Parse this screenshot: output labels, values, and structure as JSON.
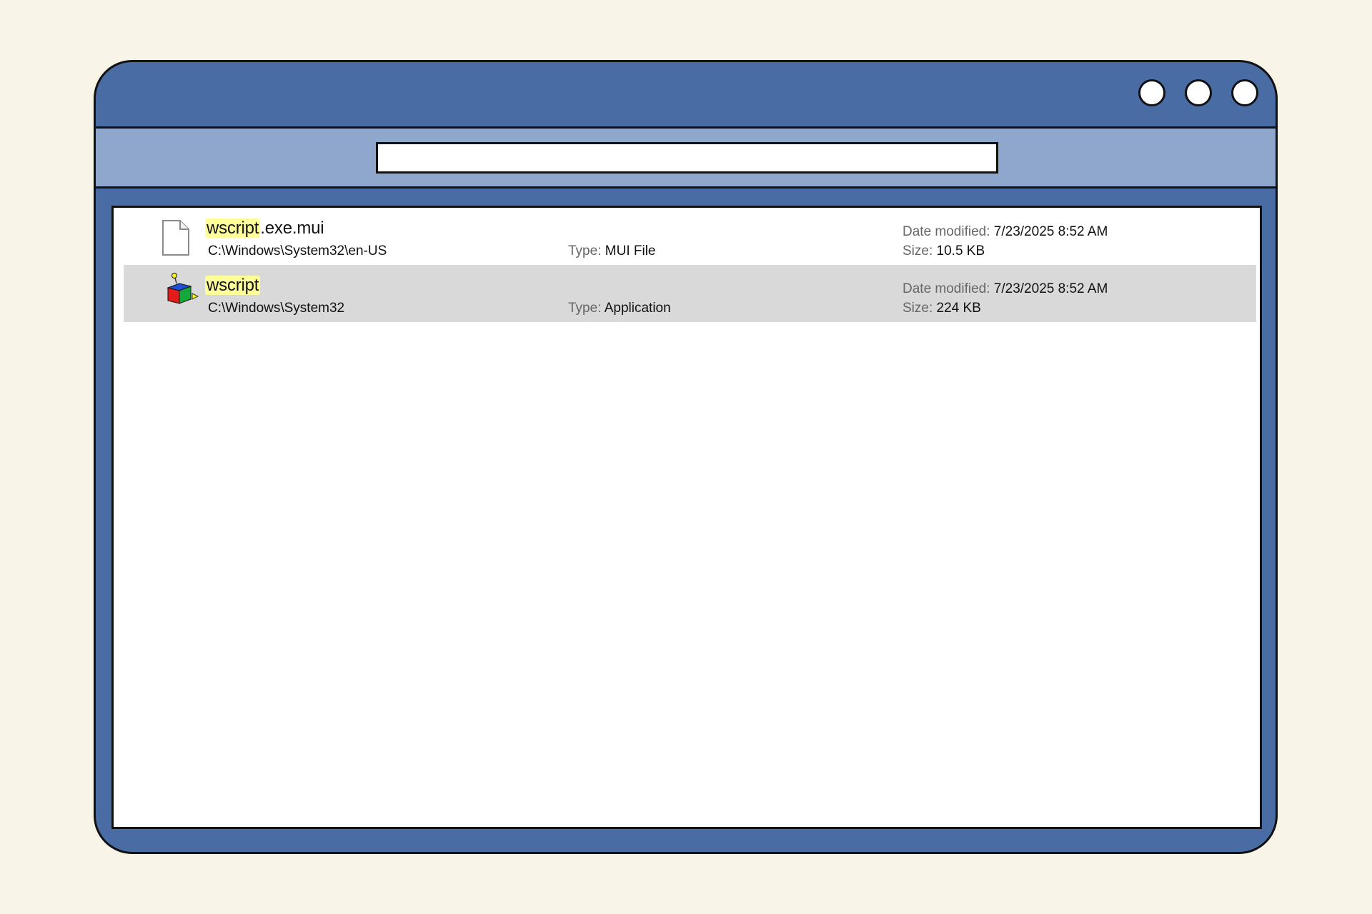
{
  "window": {
    "controls": [
      "circle-button",
      "circle-button",
      "circle-button"
    ]
  },
  "search": {
    "value": "",
    "placeholder": ""
  },
  "results": [
    {
      "name_match": "wscript",
      "name_rest": ".exe.mui",
      "path": "C:\\Windows\\System32\\en-US",
      "type_label": "Type:",
      "type_value": "MUI File",
      "date_label": "Date modified:",
      "date_value": "7/23/2025 8:52 AM",
      "size_label": "Size:",
      "size_value": "10.5 KB",
      "icon": "document-icon",
      "selected": false
    },
    {
      "name_match": "wscript",
      "name_rest": "",
      "path": "C:\\Windows\\System32",
      "type_label": "Type:",
      "type_value": "Application",
      "date_label": "Date modified:",
      "date_value": "7/23/2025 8:52 AM",
      "size_label": "Size:",
      "size_value": "224 KB",
      "icon": "script-host-icon",
      "selected": true
    }
  ],
  "colors": {
    "background": "#f9f4e8",
    "window_frame": "#4a6ca5",
    "toolbar": "#8fa6cd",
    "selected_row": "#d9d9d9",
    "highlight": "#ffff99"
  }
}
